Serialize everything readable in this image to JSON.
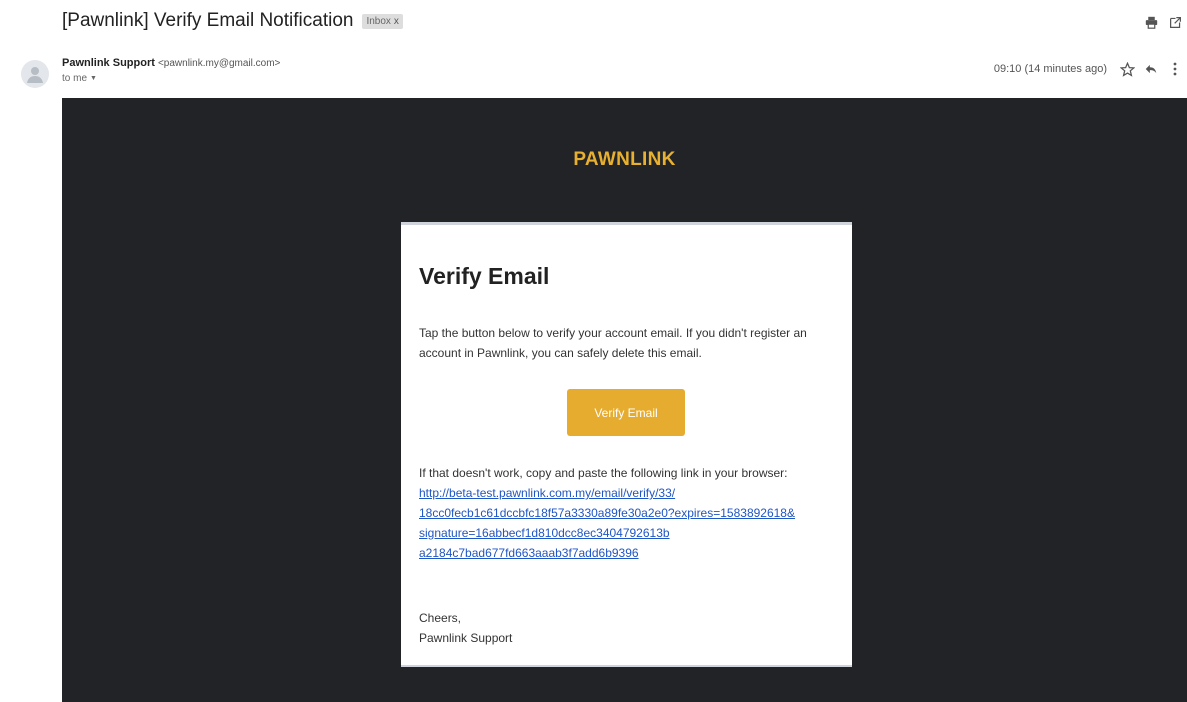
{
  "email": {
    "subject": "[Pawnlink] Verify Email Notification",
    "label": "Inbox",
    "sender_name": "Pawnlink Support",
    "sender_email": "<pawnlink.my@gmail.com>",
    "recipient": "to me",
    "timestamp": "09:10 (14 minutes ago)"
  },
  "icons": {
    "print": "print-icon",
    "open_new_window": "open-in-new-window-icon",
    "avatar": "default-avatar-icon",
    "star": "star-icon",
    "reply": "reply-icon",
    "more": "more-vertical-icon",
    "remove_label": "close-icon",
    "recipient_details": "caret-down-icon"
  },
  "message": {
    "brand": "PAWNLINK",
    "heading": "Verify Email",
    "intro": "Tap the button below to verify your account email. If you didn't register an account in Pawnlink, you can safely delete this email.",
    "button": "Verify Email",
    "fallback": "If that doesn't work, copy and paste the following link in your browser:",
    "link_lines": [
      "http://beta-test.pawnlink.com.my/email/verify/33/",
      "18cc0fecb1c61dccbfc18f57a3330a89fe30a2e0?expires=1583892618&",
      "signature=16abbecf1d810dcc8ec3404792613b",
      "a2184c7bad677fd663aaab3f7add6b9396"
    ],
    "signoff": "Cheers,",
    "signature_name": "Pawnlink Support"
  },
  "colors": {
    "banner_bg": "#222326",
    "brand": "#e8b030",
    "button_bg": "#e6ac2f",
    "link": "#1f56c5"
  }
}
